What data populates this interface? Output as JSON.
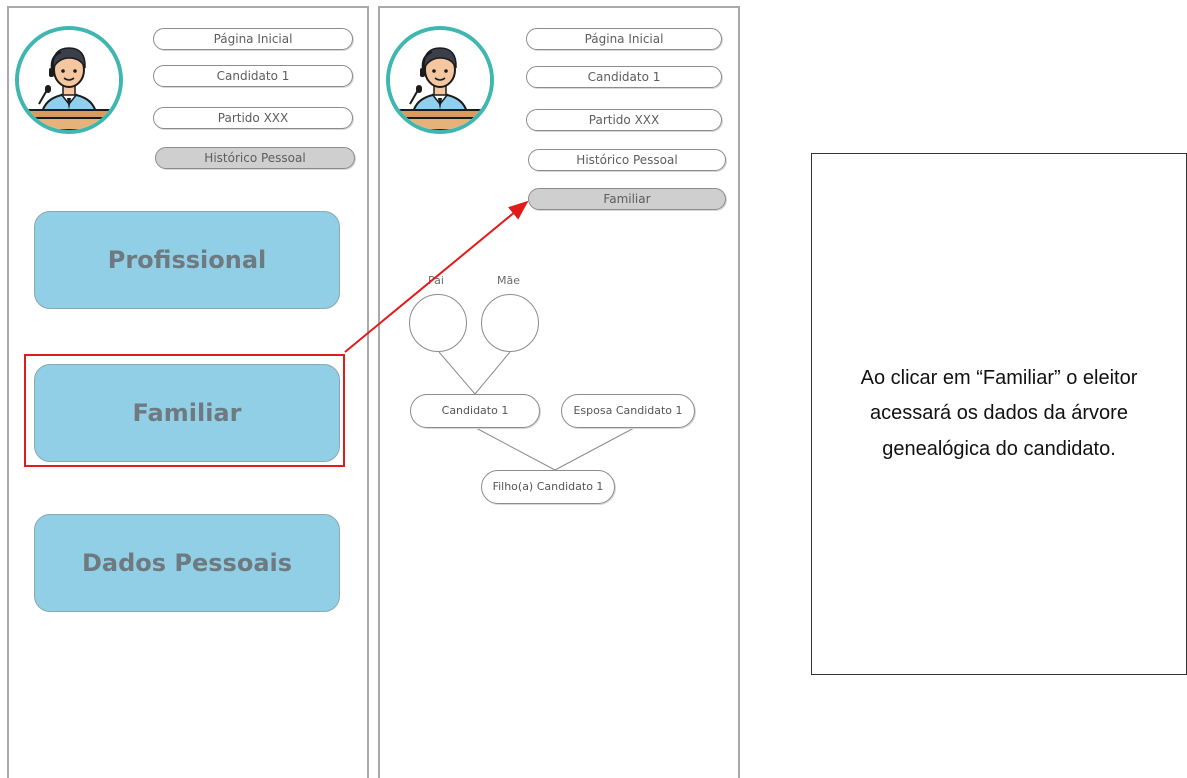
{
  "left_screen": {
    "menu": [
      {
        "label": "Página Inicial"
      },
      {
        "label": "Candidato 1"
      },
      {
        "label": "Partido XXX"
      },
      {
        "label": "Histórico Pessoal"
      }
    ],
    "buttons": [
      {
        "label": "Profissional"
      },
      {
        "label": "Familiar"
      },
      {
        "label": "Dados Pessoais"
      }
    ]
  },
  "right_screen": {
    "menu": [
      {
        "label": "Página Inicial"
      },
      {
        "label": "Candidato 1"
      },
      {
        "label": "Partido XXX"
      },
      {
        "label": "Histórico Pessoal"
      },
      {
        "label": "Familiar"
      }
    ],
    "tree": {
      "father": "Pai",
      "mother": "Mãe",
      "candidate": "Candidato 1",
      "spouse": "Esposa Candidato 1",
      "child": "Filho(a) Candidato 1"
    }
  },
  "note": {
    "text": "Ao clicar em “Familiar” o eleitor acessará os dados da árvore genealógica do candidato."
  },
  "colors": {
    "accent_teal": "#3fb6b0",
    "button_blue": "#90cfe6",
    "highlight_red": "#e11b1b",
    "active_pill": "#cfcfcf"
  }
}
